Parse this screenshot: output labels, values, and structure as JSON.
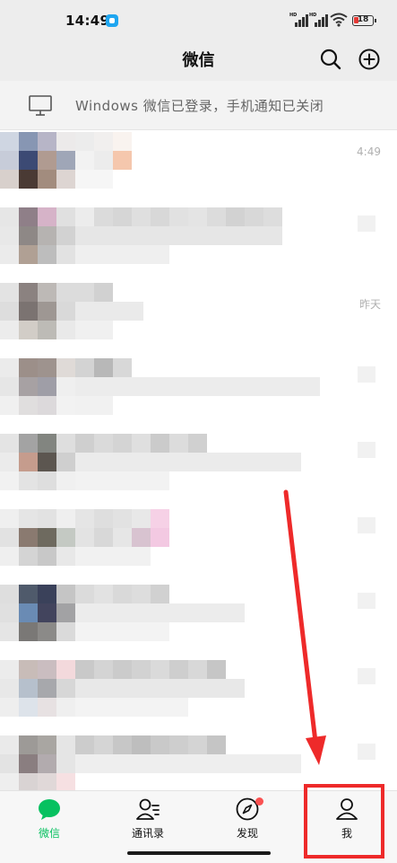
{
  "status_bar": {
    "time": "14:49",
    "battery_level": "18"
  },
  "nav": {
    "title": "微信"
  },
  "notice": {
    "text": "Windows 微信已登录，手机通知已关闭"
  },
  "chats": [
    {
      "time": "4:49"
    },
    {
      "time": ""
    },
    {
      "time": "昨天"
    },
    {
      "time": ""
    },
    {
      "time": ""
    },
    {
      "time": ""
    },
    {
      "time": ""
    },
    {
      "time": ""
    },
    {
      "time": ""
    }
  ],
  "tabs": [
    {
      "label": "微信",
      "icon": "chat-bubble-icon",
      "active": true
    },
    {
      "label": "通讯录",
      "icon": "contacts-icon",
      "active": false
    },
    {
      "label": "发现",
      "icon": "compass-icon",
      "active": false,
      "badge": true
    },
    {
      "label": "我",
      "icon": "person-icon",
      "active": false
    }
  ],
  "colors": {
    "accent_green": "#07c160",
    "annotation_red": "#ee2a2a",
    "badge_red": "#fa5151"
  }
}
